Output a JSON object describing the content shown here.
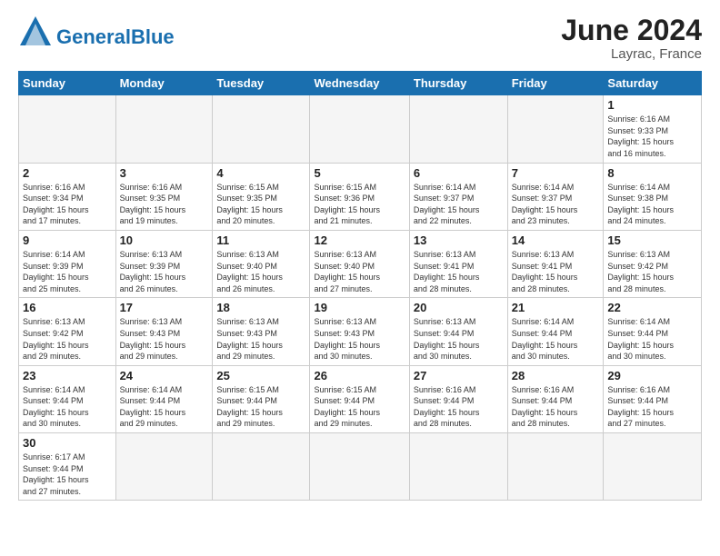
{
  "header": {
    "logo_general": "General",
    "logo_blue": "Blue",
    "month_title": "June 2024",
    "location": "Layrac, France"
  },
  "days_of_week": [
    "Sunday",
    "Monday",
    "Tuesday",
    "Wednesday",
    "Thursday",
    "Friday",
    "Saturday"
  ],
  "weeks": [
    [
      {
        "day": "",
        "info": ""
      },
      {
        "day": "",
        "info": ""
      },
      {
        "day": "",
        "info": ""
      },
      {
        "day": "",
        "info": ""
      },
      {
        "day": "",
        "info": ""
      },
      {
        "day": "",
        "info": ""
      },
      {
        "day": "1",
        "info": "Sunrise: 6:16 AM\nSunset: 9:33 PM\nDaylight: 15 hours\nand 16 minutes."
      }
    ],
    [
      {
        "day": "2",
        "info": "Sunrise: 6:16 AM\nSunset: 9:34 PM\nDaylight: 15 hours\nand 17 minutes."
      },
      {
        "day": "3",
        "info": "Sunrise: 6:16 AM\nSunset: 9:35 PM\nDaylight: 15 hours\nand 19 minutes."
      },
      {
        "day": "4",
        "info": "Sunrise: 6:15 AM\nSunset: 9:35 PM\nDaylight: 15 hours\nand 20 minutes."
      },
      {
        "day": "5",
        "info": "Sunrise: 6:15 AM\nSunset: 9:36 PM\nDaylight: 15 hours\nand 21 minutes."
      },
      {
        "day": "6",
        "info": "Sunrise: 6:14 AM\nSunset: 9:37 PM\nDaylight: 15 hours\nand 22 minutes."
      },
      {
        "day": "7",
        "info": "Sunrise: 6:14 AM\nSunset: 9:37 PM\nDaylight: 15 hours\nand 23 minutes."
      },
      {
        "day": "8",
        "info": "Sunrise: 6:14 AM\nSunset: 9:38 PM\nDaylight: 15 hours\nand 24 minutes."
      }
    ],
    [
      {
        "day": "9",
        "info": "Sunrise: 6:14 AM\nSunset: 9:39 PM\nDaylight: 15 hours\nand 25 minutes."
      },
      {
        "day": "10",
        "info": "Sunrise: 6:13 AM\nSunset: 9:39 PM\nDaylight: 15 hours\nand 26 minutes."
      },
      {
        "day": "11",
        "info": "Sunrise: 6:13 AM\nSunset: 9:40 PM\nDaylight: 15 hours\nand 26 minutes."
      },
      {
        "day": "12",
        "info": "Sunrise: 6:13 AM\nSunset: 9:40 PM\nDaylight: 15 hours\nand 27 minutes."
      },
      {
        "day": "13",
        "info": "Sunrise: 6:13 AM\nSunset: 9:41 PM\nDaylight: 15 hours\nand 28 minutes."
      },
      {
        "day": "14",
        "info": "Sunrise: 6:13 AM\nSunset: 9:41 PM\nDaylight: 15 hours\nand 28 minutes."
      },
      {
        "day": "15",
        "info": "Sunrise: 6:13 AM\nSunset: 9:42 PM\nDaylight: 15 hours\nand 28 minutes."
      }
    ],
    [
      {
        "day": "16",
        "info": "Sunrise: 6:13 AM\nSunset: 9:42 PM\nDaylight: 15 hours\nand 29 minutes."
      },
      {
        "day": "17",
        "info": "Sunrise: 6:13 AM\nSunset: 9:43 PM\nDaylight: 15 hours\nand 29 minutes."
      },
      {
        "day": "18",
        "info": "Sunrise: 6:13 AM\nSunset: 9:43 PM\nDaylight: 15 hours\nand 29 minutes."
      },
      {
        "day": "19",
        "info": "Sunrise: 6:13 AM\nSunset: 9:43 PM\nDaylight: 15 hours\nand 30 minutes."
      },
      {
        "day": "20",
        "info": "Sunrise: 6:13 AM\nSunset: 9:44 PM\nDaylight: 15 hours\nand 30 minutes."
      },
      {
        "day": "21",
        "info": "Sunrise: 6:14 AM\nSunset: 9:44 PM\nDaylight: 15 hours\nand 30 minutes."
      },
      {
        "day": "22",
        "info": "Sunrise: 6:14 AM\nSunset: 9:44 PM\nDaylight: 15 hours\nand 30 minutes."
      }
    ],
    [
      {
        "day": "23",
        "info": "Sunrise: 6:14 AM\nSunset: 9:44 PM\nDaylight: 15 hours\nand 30 minutes."
      },
      {
        "day": "24",
        "info": "Sunrise: 6:14 AM\nSunset: 9:44 PM\nDaylight: 15 hours\nand 29 minutes."
      },
      {
        "day": "25",
        "info": "Sunrise: 6:15 AM\nSunset: 9:44 PM\nDaylight: 15 hours\nand 29 minutes."
      },
      {
        "day": "26",
        "info": "Sunrise: 6:15 AM\nSunset: 9:44 PM\nDaylight: 15 hours\nand 29 minutes."
      },
      {
        "day": "27",
        "info": "Sunrise: 6:16 AM\nSunset: 9:44 PM\nDaylight: 15 hours\nand 28 minutes."
      },
      {
        "day": "28",
        "info": "Sunrise: 6:16 AM\nSunset: 9:44 PM\nDaylight: 15 hours\nand 28 minutes."
      },
      {
        "day": "29",
        "info": "Sunrise: 6:16 AM\nSunset: 9:44 PM\nDaylight: 15 hours\nand 27 minutes."
      }
    ],
    [
      {
        "day": "30",
        "info": "Sunrise: 6:17 AM\nSunset: 9:44 PM\nDaylight: 15 hours\nand 27 minutes."
      },
      {
        "day": "",
        "info": ""
      },
      {
        "day": "",
        "info": ""
      },
      {
        "day": "",
        "info": ""
      },
      {
        "day": "",
        "info": ""
      },
      {
        "day": "",
        "info": ""
      },
      {
        "day": "",
        "info": ""
      }
    ]
  ]
}
